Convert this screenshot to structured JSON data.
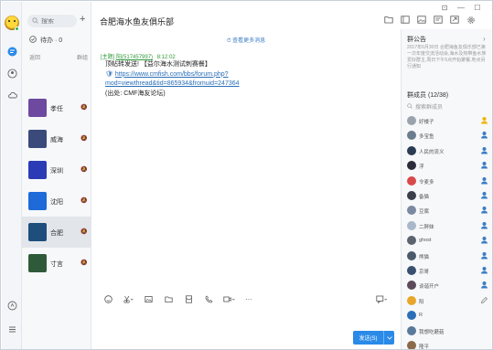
{
  "rail": {
    "icons": [
      "chat-icon",
      "contacts-icon",
      "cloud-icon",
      "mini-app-icon",
      "menu-icon"
    ]
  },
  "list": {
    "search_placeholder": "搜索",
    "todo_label": "待办 · 0",
    "subhead_left": "返回",
    "subhead_right": "群组",
    "conversations": [
      {
        "name": "孝任",
        "color": "#6d4aa0"
      },
      {
        "name": "威海",
        "color": "#3a4a7a"
      },
      {
        "name": "深圳",
        "color": "#2b3bb6"
      },
      {
        "name": "沈阳",
        "color": "#1e6ad8"
      },
      {
        "name": "合肥",
        "color": "#1d4e7c"
      },
      {
        "name": "寸言",
        "color": "#2f5a3a"
      }
    ]
  },
  "chat": {
    "title": "合肥海水鱼友俱乐部",
    "more_history": "查看更多消息",
    "meta_tag": "[主题]",
    "meta_user": "阳(517457997)",
    "meta_time": "8:12:02",
    "line1": "顶帖转发送! 【益尔海水测试刺赛餐】",
    "link1": "https://www.cmfish.com/bbs/forum.php?",
    "link2": "mod=viewthread&tid=865934&fromuid=247364",
    "line4": "(出处: CMF海友论坛)",
    "send_label": "发送(S)"
  },
  "right": {
    "notice_title": "群公告",
    "notice_text": "2017年6月30日 合肥海鱼友俱乐部已第一次年度交流活动会,海水及热带鱼水族爱好群主,周日下午5点开始聚餐,地点另行通知",
    "members_title": "群成员 (12/38)",
    "member_search": "搜索群成员",
    "members": [
      {
        "name": "好楼子",
        "color": "#9aa3ad",
        "role": "owner"
      },
      {
        "name": "多宝鱼",
        "color": "#6a7c8e",
        "role": "admin"
      },
      {
        "name": "人民的流义",
        "color": "#2a3b52",
        "role": "admin"
      },
      {
        "name": "浮",
        "color": "#2b2b3a",
        "role": "admin"
      },
      {
        "name": "令麦多",
        "color": "#d84a4a",
        "role": "admin"
      },
      {
        "name": "备猫",
        "color": "#3b3f4a",
        "role": "admin"
      },
      {
        "name": "豆腐",
        "color": "#7a8aa0",
        "role": "admin"
      },
      {
        "name": "二胖妹",
        "color": "#a8b8c8",
        "role": "admin"
      },
      {
        "name": "ghost",
        "color": "#5c6470",
        "role": "admin"
      },
      {
        "name": "熊猫",
        "color": "#4b5a6a",
        "role": "admin"
      },
      {
        "name": "京哥",
        "color": "#3a5070",
        "role": "admin"
      },
      {
        "name": "谈谐开户",
        "color": "#5a4a5a",
        "role": "admin"
      },
      {
        "name": "阳",
        "color": "#e8a62a",
        "role": "self"
      },
      {
        "name": "R",
        "color": "#2a6fb8",
        "role": "member"
      },
      {
        "name": "我想吃蘑菇",
        "color": "#5a7a9a",
        "role": "member"
      },
      {
        "name": "隆平",
        "color": "#8a6a4a",
        "role": "member"
      }
    ]
  },
  "colors": {
    "accent": "#2a8ae8",
    "owner": "#f0b400",
    "admin": "#3a7cc5"
  }
}
